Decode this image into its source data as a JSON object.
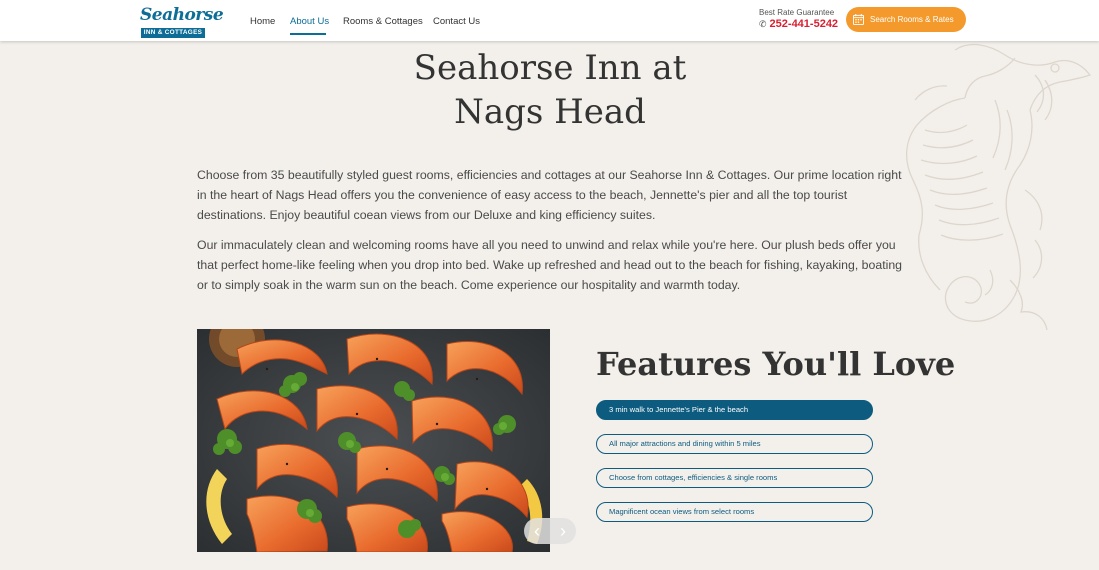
{
  "header": {
    "logo": {
      "wordmark": "Seahorse",
      "band": "INN & COTTAGES"
    },
    "nav": [
      {
        "label": "Home"
      },
      {
        "label": "About Us"
      },
      {
        "label": "Rooms & Cottages"
      },
      {
        "label": "Contact Us"
      }
    ],
    "best_rate": "Best Rate Guarantee",
    "phone": "252-441-5242",
    "cta": "Search Rooms & Rates"
  },
  "main": {
    "title_line1": "Seahorse Inn at",
    "title_line2": "Nags Head",
    "paragraphs": [
      "Choose from 35 beautifully styled guest rooms, efficiencies and cottages at our Seahorse Inn & Cottages. Our prime location right in the heart of Nags Head offers you the convenience of easy access to the beach, Jennette's pier and all the top tourist destinations. Enjoy beautiful coean views from our Deluxe and king efficiency suites.",
      "Our immaculately clean and welcoming rooms have all you need to unwind and relax while you're here. Our plush beds offer you that perfect home-like feeling when you drop into bed. Wake up refreshed and head out to the beach for fishing, kayaking, boating or to simply soak in the warm sun on the beach. Come experience our hospitality and warmth today."
    ]
  },
  "features": {
    "title": "Features You'll Love",
    "items": [
      {
        "label": "3 min walk to Jennette's Pier & the beach"
      },
      {
        "label": "All major attractions and dining within 5 miles"
      },
      {
        "label": "Choose from cottages, efficiencies & single rooms"
      },
      {
        "label": "Magnificent ocean views from select rooms"
      }
    ],
    "active_index": 0
  },
  "slider": {
    "prev_icon": "chevron-left-icon",
    "next_icon": "chevron-right-icon"
  },
  "colors": {
    "brand_blue": "#0d6d96",
    "feature_blue": "#0d5c80",
    "cta_orange": "#f49a2c",
    "phone_red": "#d72031",
    "page_bg": "#f3f0eb"
  }
}
